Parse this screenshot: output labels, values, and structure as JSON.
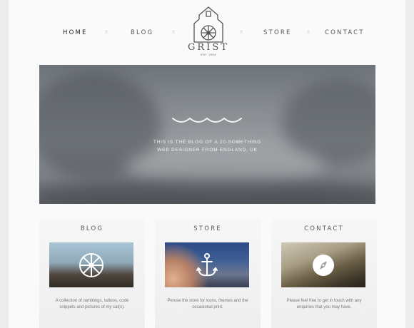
{
  "nav": {
    "home": "HOME",
    "blog": "BLOG",
    "store": "STORE",
    "contact": "CONTACT",
    "separator": "x"
  },
  "logo": {
    "title": "GRIST",
    "subtitle": "EST 1984"
  },
  "hero": {
    "line1": "This is the blog of a 20-something",
    "line2": "web designer from England, UK",
    "icon": "wave-icon"
  },
  "cards": [
    {
      "title": "BLOG",
      "icon": "wheel-icon",
      "text": "A collection of ramblings, tattoos, code snippets and pictures of my cat(s)."
    },
    {
      "title": "STORE",
      "icon": "anchor-icon",
      "text": "Peruse the store for icons, themes and the occasional print."
    },
    {
      "title": "CONTACT",
      "icon": "compass-icon",
      "text": "Please feel free to get in touch with any enquiries that you may have."
    }
  ],
  "colors": {
    "background": "#ececec",
    "page": "#fafafa",
    "text": "#555555"
  }
}
